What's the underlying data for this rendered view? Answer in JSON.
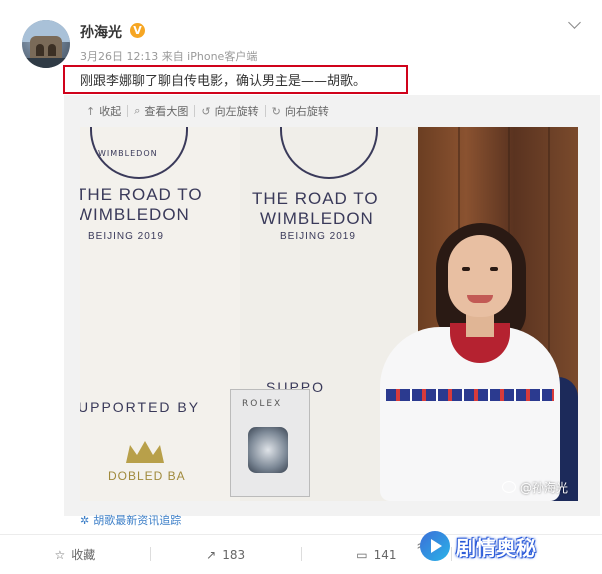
{
  "post": {
    "username": "孙海光",
    "verified_badge": "V",
    "meta": "3月26日 12:13 来自 iPhone客户端",
    "text": "刚跟李娜聊了聊自传电影，确认男主是——胡歌。"
  },
  "toolbar": {
    "collapse": "收起",
    "view_large": "查看大图",
    "rotate_left": "向左旋转",
    "rotate_right": "向右旋转"
  },
  "photo": {
    "crest_text": "WIMBLEDON",
    "road_line1": "THE ROAD TO",
    "road_line2": "WIMBLEDON",
    "beijing": "BEIJING 2019",
    "supported_by": "UPPORTED BY",
    "supp_right": "SUPPO",
    "rolex": "ROLEX",
    "crown_text": "DOBLED BA",
    "watermark": "@孙海光"
  },
  "topic": {
    "label": "胡歌最新资讯追踪"
  },
  "actions": {
    "favorite": "收藏",
    "share_count": "183",
    "comment_count": "141"
  },
  "brand": {
    "text": "剧情奥秘"
  },
  "colors": {
    "highlight_border": "#d0021b",
    "link": "#3b7ec7",
    "verified": "#f6a623"
  }
}
